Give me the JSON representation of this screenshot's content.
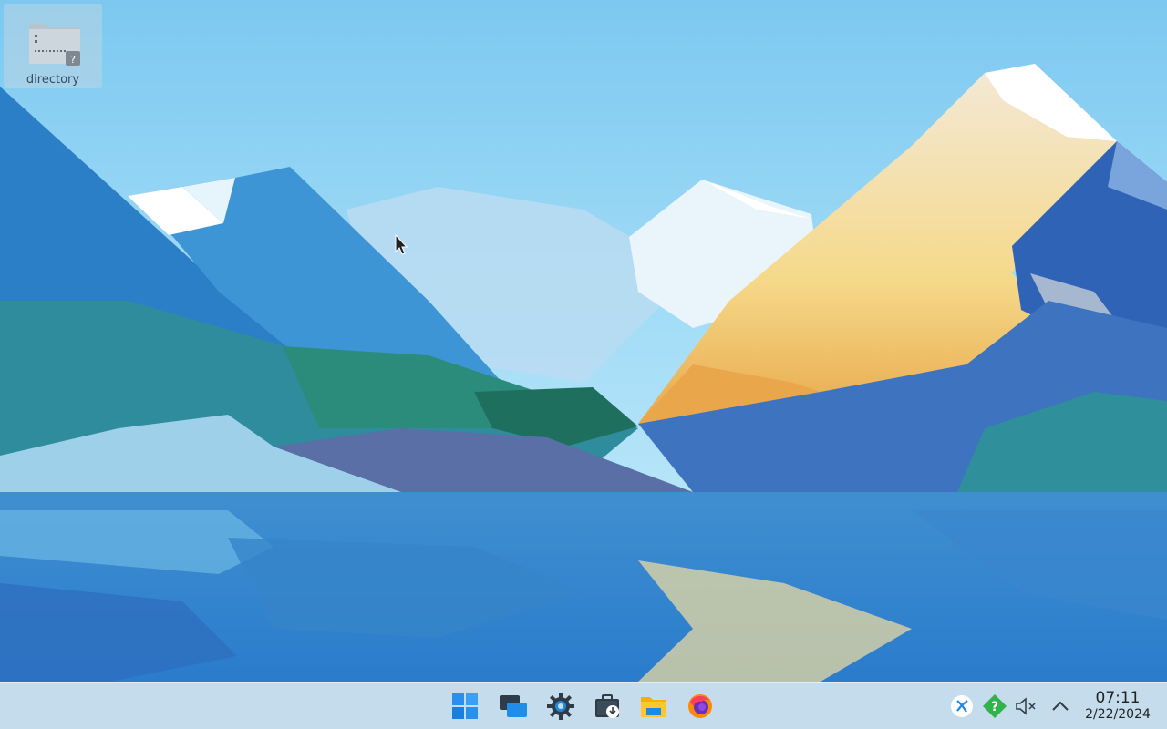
{
  "desktop": {
    "icons": [
      {
        "label": "directory",
        "icon": "unknown-folder-icon"
      }
    ]
  },
  "taskbar": {
    "apps": [
      {
        "name": "start-menu",
        "icon": "windows-start-icon"
      },
      {
        "name": "task-view",
        "icon": "task-view-icon"
      },
      {
        "name": "settings",
        "icon": "gear-icon"
      },
      {
        "name": "software-center",
        "icon": "software-store-icon"
      },
      {
        "name": "file-manager",
        "icon": "folder-icon"
      },
      {
        "name": "firefox",
        "icon": "firefox-icon"
      }
    ],
    "tray": [
      {
        "name": "kde-connect",
        "icon": "kde-icon"
      },
      {
        "name": "updates",
        "icon": "help-diamond-icon"
      },
      {
        "name": "volume-muted",
        "icon": "volume-muted-icon"
      },
      {
        "name": "show-hidden",
        "icon": "chevron-up-icon"
      }
    ],
    "clock": {
      "time": "07:11",
      "date": "2/22/2024"
    }
  },
  "colors": {
    "taskbar_bg": "#c4dcec",
    "sky": "#8fd3f3",
    "accent": "#1e88e5"
  }
}
